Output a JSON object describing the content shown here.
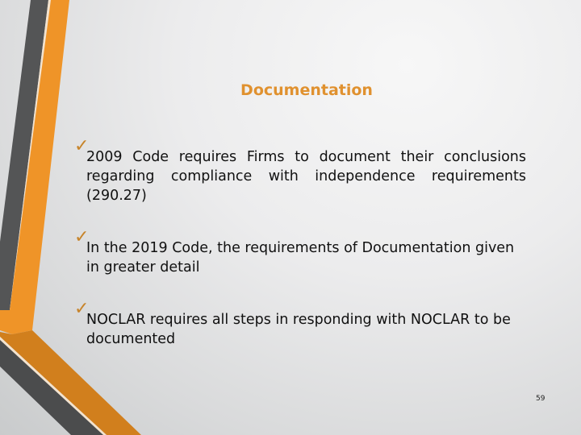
{
  "slide": {
    "title": "Documentation",
    "bullets": [
      {
        "icon": "checkmark-icon",
        "text": "2009 Code requires  Firms to document their conclusions regarding compliance with independence requirements (290.27)"
      },
      {
        "icon": "checkmark-icon",
        "text": "In the 2019 Code, the requirements of Documentation given in greater detail"
      },
      {
        "icon": "checkmark-icon",
        "text": "NOCLAR requires all steps in responding with NOCLAR to be documented"
      }
    ],
    "page_number": "59"
  },
  "colors": {
    "accent_orange": "#ef9428",
    "accent_orange_dark": "#d17f1d",
    "stripe_gray": "#545556",
    "title_color": "#e0912f",
    "check_color": "#c7842a"
  }
}
